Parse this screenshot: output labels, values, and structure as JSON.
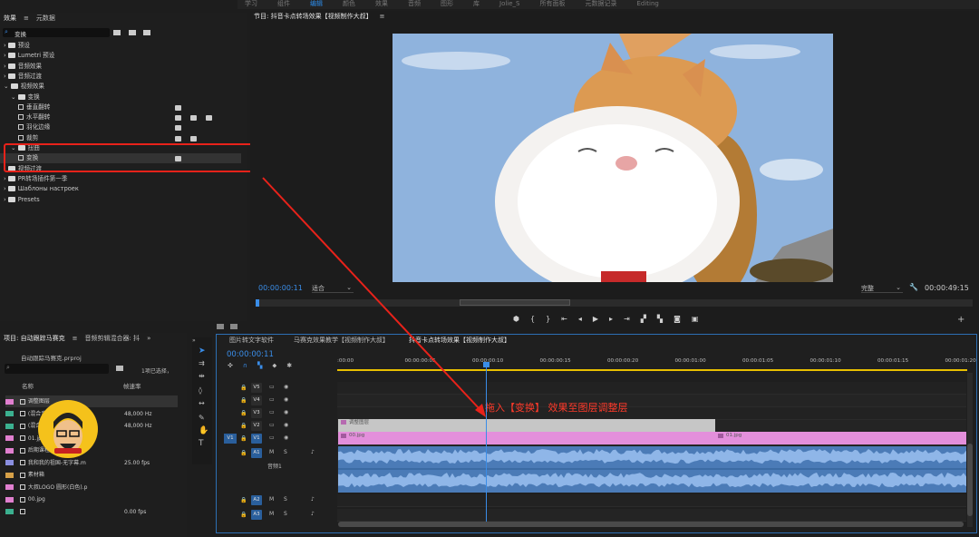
{
  "workspace": {
    "items": [
      "学习",
      "组件",
      "编辑",
      "颜色",
      "效果",
      "音频",
      "图形",
      "库",
      "Jolie_S",
      "所有面板",
      "元数据记录",
      "Editing"
    ],
    "active_index": 2
  },
  "effects_panel": {
    "tabs": [
      {
        "label": "效果",
        "active": true
      },
      {
        "label": "元数据",
        "active": false
      }
    ],
    "search_value": "变换",
    "tree": [
      {
        "label": "预设",
        "indent": 0,
        "kind": "folder"
      },
      {
        "label": "Lumetri 预设",
        "indent": 0,
        "kind": "folder"
      },
      {
        "label": "音频效果",
        "indent": 0,
        "kind": "folder"
      },
      {
        "label": "音频过渡",
        "indent": 0,
        "kind": "folder"
      },
      {
        "label": "视频效果",
        "indent": 0,
        "kind": "folder",
        "open": true
      },
      {
        "label": "变换",
        "indent": 1,
        "kind": "folder",
        "open": true
      },
      {
        "label": "垂直翻转",
        "indent": 2,
        "kind": "fx",
        "badges": 1
      },
      {
        "label": "水平翻转",
        "indent": 2,
        "kind": "fx",
        "badges": 3
      },
      {
        "label": "羽化边缘",
        "indent": 2,
        "kind": "fx",
        "badges": 1
      },
      {
        "label": "裁剪",
        "indent": 2,
        "kind": "fx",
        "badges": 2
      },
      {
        "label": "扭曲",
        "indent": 1,
        "kind": "folder",
        "open": true
      },
      {
        "label": "变换",
        "indent": 2,
        "kind": "fx",
        "badges": 1,
        "selected": true
      },
      {
        "label": "视频过渡",
        "indent": 0,
        "kind": "folder"
      },
      {
        "label": "PR转场插件第一季",
        "indent": 0,
        "kind": "folder"
      },
      {
        "label": "Шаблоны настроек",
        "indent": 0,
        "kind": "folder"
      },
      {
        "label": "Presets",
        "indent": 0,
        "kind": "folder"
      }
    ]
  },
  "program_monitor": {
    "title": "节目: 抖音卡点转场效果【视频制作大叔】",
    "timecode": "00:00:00:11",
    "fit_option": "适合",
    "quality_option": "完整",
    "duration": "00:00:49:15",
    "sky_color": "#8fb3dd"
  },
  "project_panel": {
    "tabs": [
      {
        "label": "项目: 自动跟踪马赛克",
        "active": true
      },
      {
        "label": "音频剪辑混合器: 抖",
        "active": false
      }
    ],
    "file": "自动跟踪马赛克.prproj",
    "selection_info": "1项已选择，",
    "columns": [
      "名称",
      "帧速率"
    ],
    "rows": [
      {
        "name": "调整图层",
        "rate": "",
        "color": "#e07fcf"
      },
      {
        "name": "(混合音门)",
        "rate": "48,000 Hz",
        "color": "#3bb08f"
      },
      {
        "name": "(混合音门)",
        "rate": "48,000 Hz",
        "color": "#3bb08f"
      },
      {
        "name": "01.jpg",
        "rate": "",
        "color": "#e07fcf"
      },
      {
        "name": "后期课程获取 关注微信",
        "rate": "",
        "color": "#e07fcf"
      },
      {
        "name": "我和我的祖国-无字幕.m",
        "rate": "25.00 fps",
        "color": "#8a8fe0"
      },
      {
        "name": "素材箱",
        "rate": "",
        "color": "#d6a048"
      },
      {
        "name": "大叔LOGO 圆形(白色).p",
        "rate": "",
        "color": "#e07fcf"
      },
      {
        "name": "00.jpg",
        "rate": "",
        "color": "#e07fcf"
      },
      {
        "name": "",
        "rate": "0.00 fps",
        "color": "#3bb08f"
      }
    ]
  },
  "timeline": {
    "tabs": [
      {
        "label": "图片转文字软件",
        "active": false
      },
      {
        "label": "马赛克效果教学【视频制作大叔】",
        "active": false
      },
      {
        "label": "抖音卡点转场效果【视频制作大叔】",
        "active": true
      }
    ],
    "timecode": "00:00:00:11",
    "ruler": [
      ":00:00",
      "00:00:00:05",
      "00:00:00:10",
      "00:00:00:15",
      "00:00:00:20",
      "00:00:01:00",
      "00:00:01:05",
      "00:00:01:10",
      "00:00:01:15",
      "00:00:01:20"
    ],
    "tracks": [
      "V5",
      "V4",
      "V3",
      "V2",
      "V1",
      "A1",
      "A2",
      "A3"
    ],
    "source_patch": {
      "video": "V1"
    },
    "clips": {
      "adjustment": "调整图层",
      "image1": "00.jpg",
      "image2": "01.jpg",
      "audio_label": "音频1"
    },
    "annotation": "拖入【变换】 效果至图层调整层"
  }
}
